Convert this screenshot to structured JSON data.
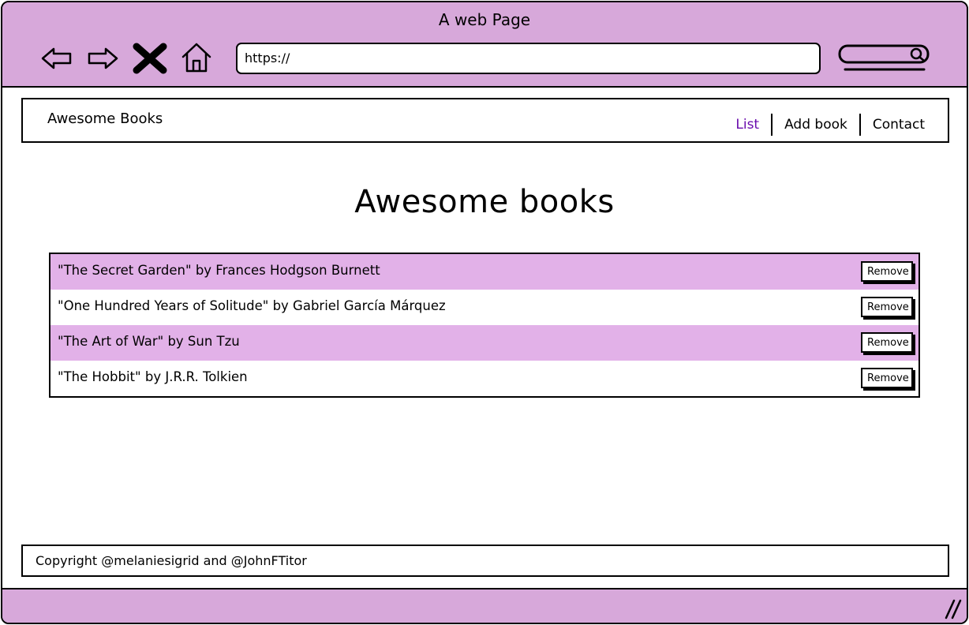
{
  "browser": {
    "title": "A web Page",
    "url": "https://",
    "icons": [
      "back-arrow-icon",
      "forward-arrow-icon",
      "close-x-icon",
      "home-icon",
      "search-icon",
      "resize-grip-icon"
    ]
  },
  "header": {
    "brand": "Awesome Books",
    "nav": [
      {
        "label": "List",
        "active": true
      },
      {
        "label": "Add book",
        "active": false
      },
      {
        "label": "Contact",
        "active": false
      }
    ]
  },
  "main": {
    "heading": "Awesome books",
    "books": [
      {
        "text": "\"The Secret Garden\" by Frances Hodgson Burnett",
        "button": "Remove"
      },
      {
        "text": "\"One Hundred Years of Solitude\" by Gabriel García Márquez",
        "button": "Remove"
      },
      {
        "text": "\"The Art of War\" by Sun Tzu",
        "button": "Remove"
      },
      {
        "text": "\"The Hobbit\" by J.R.R. Tolkien",
        "button": "Remove"
      }
    ]
  },
  "footer": {
    "copyright": "Copyright @melaniesigrid and @JohnFTitor"
  },
  "colors": {
    "chrome": "#d7a8da",
    "row_highlight": "#e2b1e8",
    "active_link": "#6a0dad"
  }
}
